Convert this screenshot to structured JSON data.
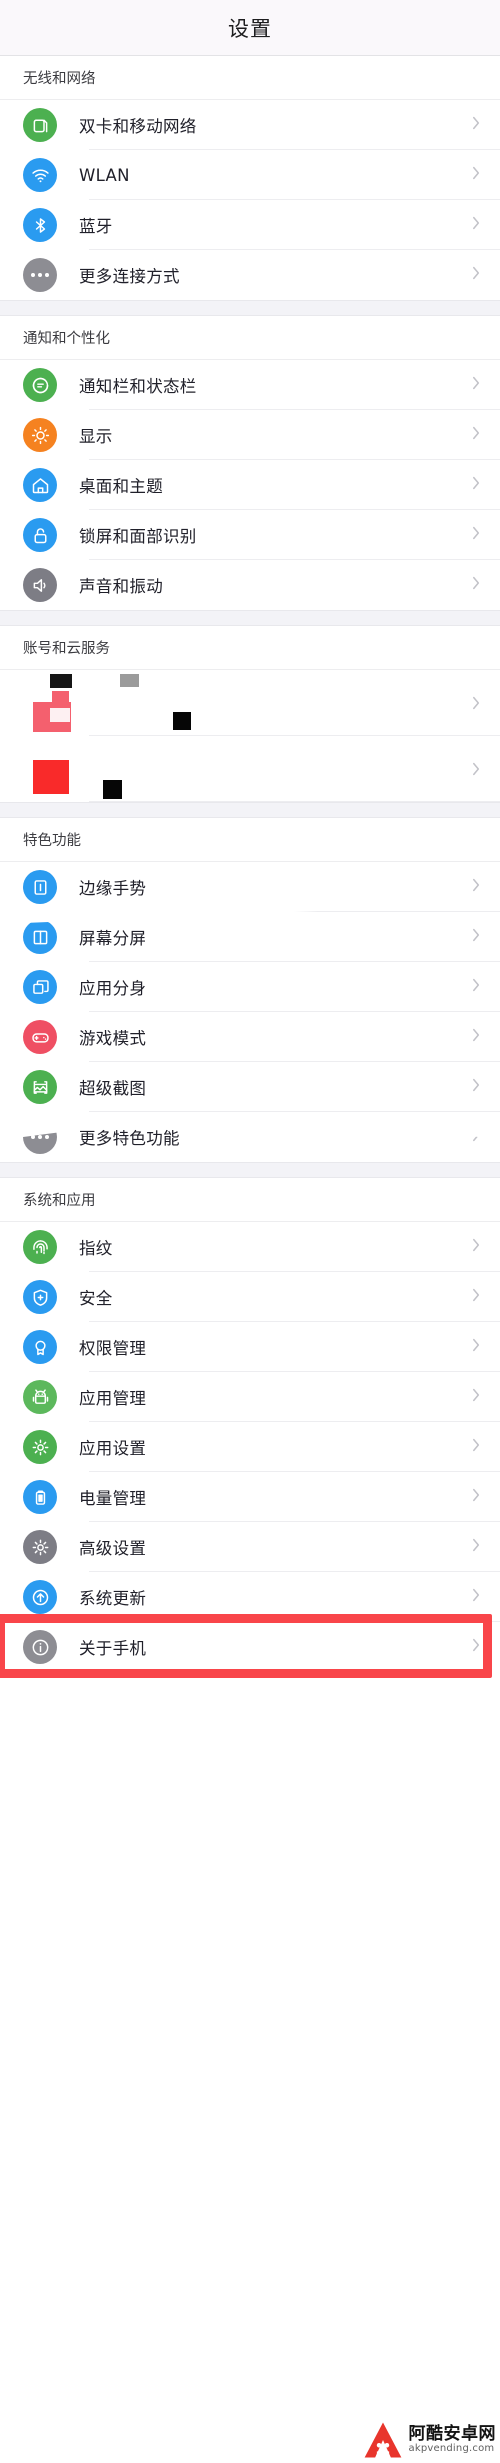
{
  "header": {
    "title": "设置"
  },
  "colors": {
    "accent_highlight": "#f9454a",
    "page_bg": "#ffffff",
    "group_bg": "#f3f3f7",
    "titlebar_bg": "#faf8fb",
    "chevron": "#c2c2c8",
    "green": "#4cb050",
    "blue": "#2a9bf0",
    "orange": "#f58220",
    "gray": "#8d8d93",
    "pink": "#ef4f63",
    "redact_black": "#161616",
    "redact_gray": "#9b9b9b",
    "redact_pink": "#f4606e",
    "redact_red": "#f92a2a"
  },
  "sections": [
    {
      "id": "wireless-network",
      "title": "无线和网络",
      "items": [
        {
          "label": "双卡和移动网络",
          "icon": "sim-card-icon",
          "icon_color": "#4cb050"
        },
        {
          "label": "WLAN",
          "icon": "wifi-icon",
          "icon_color": "#2a9bf0"
        },
        {
          "label": "蓝牙",
          "icon": "bluetooth-icon",
          "icon_color": "#2a9bf0"
        },
        {
          "label": "更多连接方式",
          "icon": "more-dots-icon",
          "icon_color": "#8d8d93"
        }
      ]
    },
    {
      "id": "notification-personalization",
      "title": "通知和个性化",
      "items": [
        {
          "label": "通知栏和状态栏",
          "icon": "notification-bubble-icon",
          "icon_color": "#4cb050"
        },
        {
          "label": "显示",
          "icon": "brightness-sun-icon",
          "icon_color": "#f58220"
        },
        {
          "label": "桌面和主题",
          "icon": "home-house-icon",
          "icon_color": "#2a9bf0"
        },
        {
          "label": "锁屏和面部识别",
          "icon": "lock-icon",
          "icon_color": "#2a9bf0"
        },
        {
          "label": "声音和振动",
          "icon": "speaker-volume-icon",
          "icon_color": "#7d7d85"
        }
      ]
    },
    {
      "id": "account-cloud",
      "title": "账号和云服务",
      "items": [
        {
          "label": "",
          "icon": "redacted-icon",
          "icon_color": "#ffffff",
          "redacted": true
        },
        {
          "label": "",
          "icon": "redacted-icon",
          "icon_color": "#ffffff",
          "redacted": true
        }
      ]
    },
    {
      "id": "featured-functions",
      "title": "特色功能",
      "items": [
        {
          "label": "边缘手势",
          "icon": "edge-gesture-icon",
          "icon_color": "#2a9bf0"
        },
        {
          "label": "屏幕分屏",
          "icon": "split-screen-icon",
          "icon_color": "#2a9bf0"
        },
        {
          "label": "应用分身",
          "icon": "app-clone-icon",
          "icon_color": "#2a9bf0"
        },
        {
          "label": "游戏模式",
          "icon": "gamepad-icon",
          "icon_color": "#ef4f63"
        },
        {
          "label": "超级截图",
          "icon": "screenshot-icon",
          "icon_color": "#4cb050"
        },
        {
          "label": "更多特色功能",
          "icon": "more-dots-icon",
          "icon_color": "#8d8d93"
        }
      ]
    },
    {
      "id": "system-applications",
      "title": "系统和应用",
      "items": [
        {
          "label": "指纹",
          "icon": "fingerprint-icon",
          "icon_color": "#4cb050"
        },
        {
          "label": "安全",
          "icon": "shield-plus-icon",
          "icon_color": "#2a9bf0"
        },
        {
          "label": "权限管理",
          "icon": "permission-badge-icon",
          "icon_color": "#2a9bf0"
        },
        {
          "label": "应用管理",
          "icon": "android-robot-icon",
          "icon_color": "#5cb85c"
        },
        {
          "label": "应用设置",
          "icon": "gear-icon",
          "icon_color": "#4cb050"
        },
        {
          "label": "电量管理",
          "icon": "battery-icon",
          "icon_color": "#2a9bf0"
        },
        {
          "label": "高级设置",
          "icon": "gear-icon",
          "icon_color": "#7d7d85"
        },
        {
          "label": "系统更新",
          "icon": "arrow-up-circle-icon",
          "icon_color": "#2a9bf0"
        },
        {
          "label": "关于手机",
          "icon": "info-circle-icon",
          "icon_color": "#8d8d93",
          "highlighted": true
        }
      ]
    }
  ],
  "watermark": {
    "cn": "阿酷安卓网",
    "en": "akpvending.com"
  }
}
